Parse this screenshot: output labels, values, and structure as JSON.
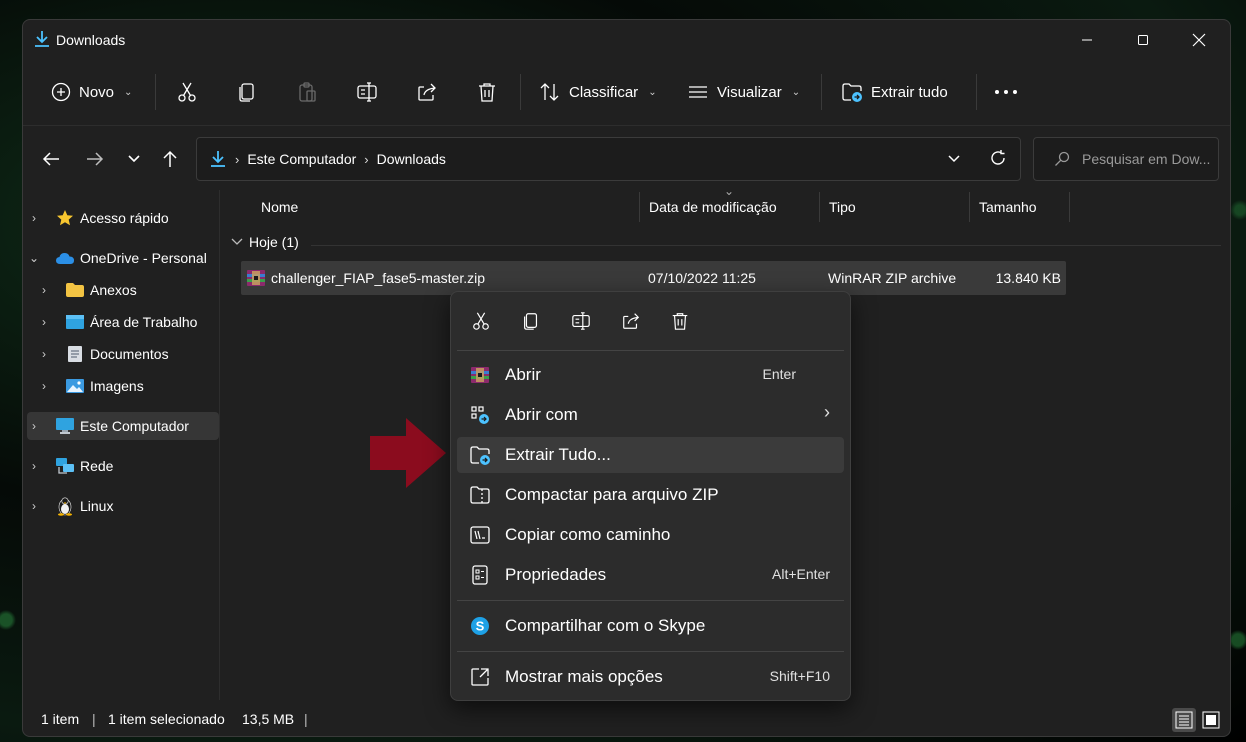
{
  "window": {
    "title": "Downloads"
  },
  "toolbar": {
    "new_label": "Novo",
    "sort_label": "Classificar",
    "view_label": "Visualizar",
    "extract_all_label": "Extrair tudo"
  },
  "address": {
    "crumbs": [
      "Este Computador",
      "Downloads"
    ],
    "search_placeholder": "Pesquisar em Dow..."
  },
  "sidebar": {
    "items": [
      {
        "label": "Acesso rápido",
        "icon": "star-icon"
      },
      {
        "label": "OneDrive - Personal",
        "icon": "cloud-icon"
      },
      {
        "label": "Anexos",
        "icon": "folder-icon"
      },
      {
        "label": "Área de Trabalho",
        "icon": "desktop-icon"
      },
      {
        "label": "Documentos",
        "icon": "document-icon"
      },
      {
        "label": "Imagens",
        "icon": "image-icon"
      },
      {
        "label": "Este Computador",
        "icon": "computer-icon"
      },
      {
        "label": "Rede",
        "icon": "network-icon"
      },
      {
        "label": "Linux",
        "icon": "linux-icon"
      }
    ]
  },
  "columns": [
    "Nome",
    "Data de modificação",
    "Tipo",
    "Tamanho"
  ],
  "group": {
    "label": "Hoje (1)"
  },
  "files": [
    {
      "name": "challenger_FIAP_fase5-master.zip",
      "modified": "07/10/2022 11:25",
      "type": "WinRAR ZIP archive",
      "size": "13.840 KB"
    }
  ],
  "status": {
    "count": "1 item",
    "selected": "1 item selecionado",
    "size": "13,5 MB"
  },
  "context_menu": {
    "items": [
      {
        "label": "Abrir",
        "shortcut": "Enter",
        "icon": "winrar-icon"
      },
      {
        "label": "Abrir com",
        "shortcut": "",
        "icon": "open-with-icon"
      },
      {
        "label": "Extrair Tudo...",
        "shortcut": "",
        "icon": "extract-icon"
      },
      {
        "label": "Compactar para arquivo ZIP",
        "shortcut": "",
        "icon": "zip-icon"
      },
      {
        "label": "Copiar como caminho",
        "shortcut": "",
        "icon": "copy-path-icon"
      },
      {
        "label": "Propriedades",
        "shortcut": "Alt+Enter",
        "icon": "properties-icon"
      },
      {
        "label": "Compartilhar com o Skype",
        "shortcut": "",
        "icon": "skype-icon"
      },
      {
        "label": "Mostrar mais opções",
        "shortcut": "Shift+F10",
        "icon": "more-options-icon"
      }
    ]
  },
  "colors": {
    "accent": "#4cc2ff",
    "pointer_arrow": "#8b0c1e",
    "window_bg": "#202020",
    "menu_bg": "#2c2c2c"
  }
}
